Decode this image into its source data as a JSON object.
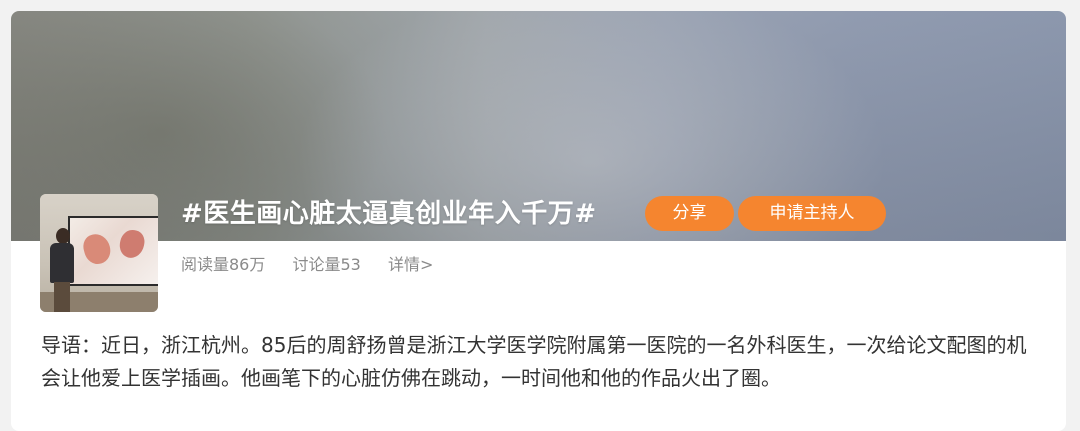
{
  "topic": {
    "title": "#医生画心脏太逼真创业年入千万#",
    "share_label": "分享",
    "apply_host_label": "申请主持人",
    "stats": {
      "reads": "阅读量86万",
      "discussions": "讨论量53",
      "details": "详情>"
    },
    "intro": "导语：近日，浙江杭州。85后的周舒扬曾是浙江大学医学院附属第一医院的一名外科医生，一次给论文配图的机会让他爱上医学插画。他画笔下的心脏仿佛在跳动，一时间他和他的作品火出了圈。"
  },
  "colors": {
    "accent": "#f5852f",
    "stat_text": "#8a8a8a",
    "body_text": "#333333"
  }
}
